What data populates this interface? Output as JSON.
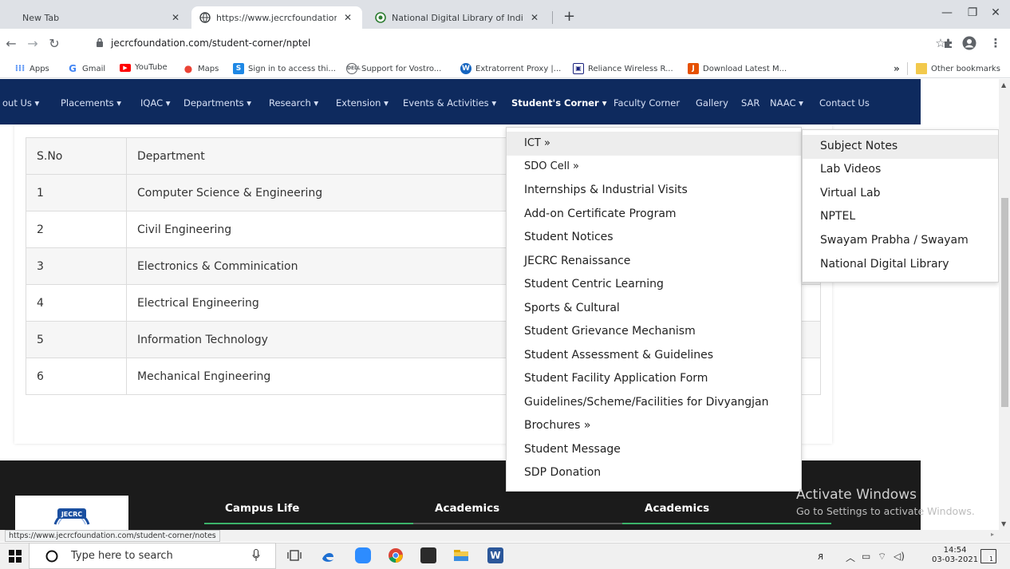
{
  "browser": {
    "tabs": [
      {
        "label": "New Tab",
        "active": false
      },
      {
        "label": "https://www.jecrcfoundation.com",
        "active": true
      },
      {
        "label": "National Digital Library of India",
        "active": false
      }
    ],
    "new_tab": "+",
    "url": "jecrcfoundation.com/student-corner/nptel",
    "bookmarks": [
      {
        "label": "Apps",
        "color": "#4285f4"
      },
      {
        "label": "Gmail",
        "color": "#4285f4"
      },
      {
        "label": "YouTube",
        "color": "#ff0000"
      },
      {
        "label": "Maps",
        "color": "#34a853"
      },
      {
        "label": "Sign in to access thi...",
        "color": "#1e88e5"
      },
      {
        "label": "Support for Vostro...",
        "color": "#5f6368"
      },
      {
        "label": "Extratorrent Proxy |...",
        "color": "#1565c0"
      },
      {
        "label": "Reliance Wireless R...",
        "color": "#1a237e"
      },
      {
        "label": "Download Latest M...",
        "color": "#e65100"
      }
    ],
    "bookmarks_more": "»",
    "other_bookmarks": "Other bookmarks"
  },
  "site_nav": {
    "items": [
      "out Us ▾",
      "Placements ▾",
      "IQAC ▾",
      "Departments ▾",
      "Research ▾",
      "Extension ▾",
      "Events & Activities ▾",
      "Student's Corner ▾",
      "Faculty Corner",
      "Gallery",
      "SAR",
      "NAAC ▾",
      "Contact Us"
    ]
  },
  "table": {
    "headers": [
      "S.No",
      "Department"
    ],
    "rows": [
      [
        "1",
        "Computer Science & Engineering"
      ],
      [
        "2",
        "Civil Engineering"
      ],
      [
        "3",
        "Electronics & Comminication"
      ],
      [
        "4",
        "Electrical Engineering"
      ],
      [
        "5",
        "Information Technology"
      ],
      [
        "6",
        "Mechanical Engineering"
      ]
    ]
  },
  "dropdown_main": {
    "items": [
      "ICT »",
      "SDO Cell »",
      "Internships & Industrial Visits",
      "Add-on Certificate Program",
      "Student Notices",
      "JECRC Renaissance",
      "Student Centric Learning",
      "Sports & Cultural",
      "Student Grievance Mechanism",
      "Student Assessment & Guidelines",
      "Student Facility Application Form",
      "Guidelines/Scheme/Facilities for Divyangjan",
      "Brochures »",
      "Student Message",
      "SDP Donation"
    ]
  },
  "dropdown_sub": {
    "items": [
      "Subject Notes",
      "Lab Videos",
      "Virtual Lab",
      "NPTEL",
      "Swayam Prabha / Swayam",
      "National Digital Library"
    ]
  },
  "footer": {
    "logo_text": "JECRC",
    "headings": [
      "Campus Life",
      "Academics",
      "Academics"
    ],
    "accent_color": "#3bb36a"
  },
  "watermark": {
    "line1": "Activate Windows",
    "line2": "Go to Settings to activate Windows."
  },
  "status_url": "https://www.jecrcfoundation.com/student-corner/notes",
  "taskbar": {
    "search_placeholder": "Type here to search",
    "time": "14:54",
    "date": "03-03-2021",
    "notification_count": "1"
  }
}
